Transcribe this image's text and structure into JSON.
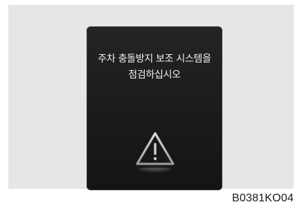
{
  "display": {
    "message_line1": "주차 충돌방지 보조 시스템을",
    "message_line2": "점검하십시오",
    "icon": "warning-triangle-icon"
  },
  "caption": "B0381KO04",
  "colors": {
    "background": "#e6e6e6",
    "screen": "#1c1c1c",
    "text": "#f2f2f2",
    "icon": "#bdbdbd"
  }
}
